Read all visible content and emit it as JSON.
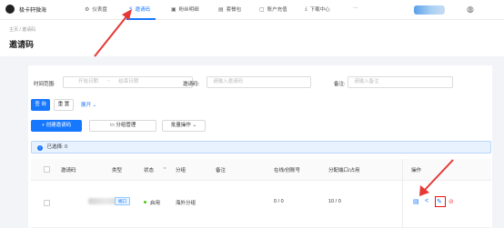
{
  "header": {
    "app_name": "极卡轩微海",
    "nav": [
      {
        "label": "仪表盘",
        "icon": "dashboard-icon"
      },
      {
        "label": "邀请码",
        "icon": "share-icon",
        "active": true
      },
      {
        "label": "粉丝明细",
        "icon": "image-icon"
      },
      {
        "label": "套餐包",
        "icon": "package-icon"
      },
      {
        "label": "账户充值",
        "icon": "wallet-icon"
      },
      {
        "label": "下载中心",
        "icon": "download-icon"
      },
      {
        "label": "···",
        "icon": "more-icon"
      }
    ],
    "accent": "#1677ff"
  },
  "page": {
    "breadcrumb": "主页 / 邀请码",
    "title": "邀请码"
  },
  "filters": {
    "time_label": "时间范围:",
    "start_placeholder": "开始日期",
    "range_sep": "~",
    "end_placeholder": "结束日期",
    "code_label": "邀请码:",
    "code_placeholder": "请输入邀请码",
    "remark_label": "备注:",
    "remark_placeholder": "请输入备注",
    "query": "查 询",
    "reset": "重 置",
    "expand": "展开"
  },
  "actions": {
    "create": "+ 创建邀请码",
    "group_manage": "分组管理",
    "batch": "批量操作"
  },
  "info": {
    "selected": "已选择: 0"
  },
  "table": {
    "columns": [
      "邀请码",
      "类型",
      "状态",
      "分组",
      "备注",
      "在线/创账号",
      "分配端口/占用",
      "操作"
    ],
    "rows": [
      {
        "type": "端口",
        "status": "启用",
        "group": "海外分组",
        "remark": "",
        "online": "0 / 0",
        "ports": "10 / 0"
      }
    ]
  }
}
